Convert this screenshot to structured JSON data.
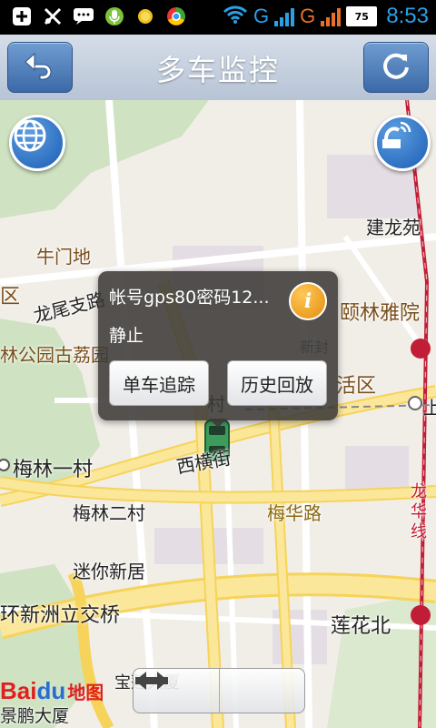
{
  "status_bar": {
    "network_type_1": "G",
    "network_type_2": "G",
    "sim_1": "1",
    "sim_2": "2",
    "battery": "75",
    "time": "8:53"
  },
  "header": {
    "title": "多车监控",
    "back_icon": "back-arrow-icon",
    "refresh_icon": "refresh-icon"
  },
  "map": {
    "labels": {
      "jianlong": "建龙苑",
      "niumen": "牛门地",
      "qu_left": "区",
      "longwei": "龙尾支路",
      "yilin": "颐林雅院",
      "park": "林公园古荔园",
      "huoqu": "活区",
      "shang": "上",
      "meilin1": "梅林一村",
      "xiheng": "西横街",
      "meilin2": "梅林二村",
      "meihua": "梅华路",
      "longhua": "龙华线",
      "mini": "迷你新居",
      "xinzhou": "环新洲立交桥",
      "lianhua": "莲花北",
      "baolian": "宝莲大厦",
      "jingpeng": "景鹏大厦",
      "cun": "村",
      "xinfeng": "新封"
    },
    "logo": {
      "bai": "Bai",
      "du": "du",
      "cn": "地图"
    }
  },
  "popup": {
    "title": "帐号gps80密码12...",
    "status": "静止",
    "track_button": "单车追踪",
    "history_button": "历史回放",
    "info_icon_letter": "i"
  }
}
